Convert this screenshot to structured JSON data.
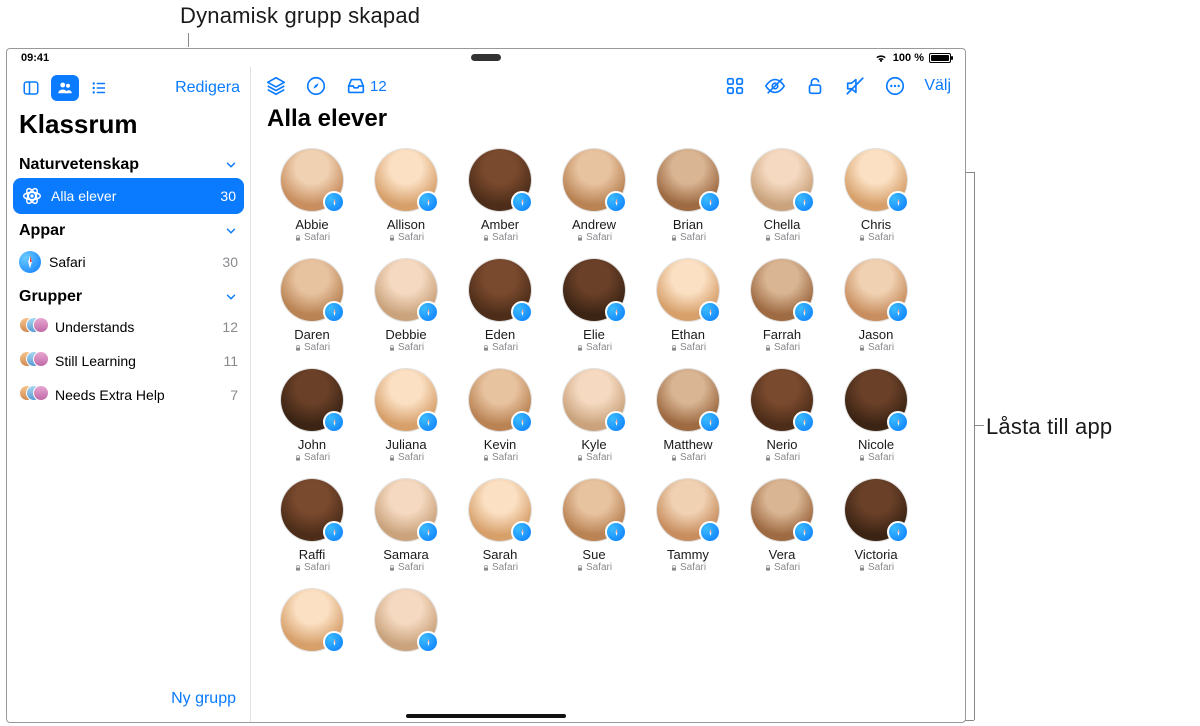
{
  "callouts": {
    "top": "Dynamisk grupp skapad",
    "right": "Låsta till app"
  },
  "statusbar": {
    "time": "09:41",
    "battery_pct": "100 %"
  },
  "sidebar": {
    "edit_label": "Redigera",
    "app_title": "Klassrum",
    "sections": {
      "subject": {
        "name": "Naturvetenskap",
        "all_students": "Alla elever",
        "all_count": "30"
      },
      "apps": {
        "header": "Appar",
        "items": [
          {
            "name": "Safari",
            "count": "30"
          }
        ]
      },
      "groups": {
        "header": "Grupper",
        "items": [
          {
            "name": "Understands",
            "count": "12"
          },
          {
            "name": "Still Learning",
            "count": "11"
          },
          {
            "name": "Needs Extra Help",
            "count": "7"
          }
        ]
      }
    },
    "new_group_label": "Ny grupp"
  },
  "main": {
    "page_title": "Alla elever",
    "select_label": "Välj",
    "inbox_count": "12",
    "student_app": "Safari",
    "students": [
      {
        "name": "Abbie",
        "c": 0
      },
      {
        "name": "Allison",
        "c": 1
      },
      {
        "name": "Amber",
        "c": 2
      },
      {
        "name": "Andrew",
        "c": 3
      },
      {
        "name": "Brian",
        "c": 4
      },
      {
        "name": "Chella",
        "c": 5
      },
      {
        "name": "Chris",
        "c": 1
      },
      {
        "name": "Daren",
        "c": 3
      },
      {
        "name": "Debbie",
        "c": 5
      },
      {
        "name": "Eden",
        "c": 2
      },
      {
        "name": "Elie",
        "c": 6
      },
      {
        "name": "Ethan",
        "c": 1
      },
      {
        "name": "Farrah",
        "c": 4
      },
      {
        "name": "Jason",
        "c": 0
      },
      {
        "name": "John",
        "c": 6
      },
      {
        "name": "Juliana",
        "c": 1
      },
      {
        "name": "Kevin",
        "c": 3
      },
      {
        "name": "Kyle",
        "c": 5
      },
      {
        "name": "Matthew",
        "c": 4
      },
      {
        "name": "Nerio",
        "c": 2
      },
      {
        "name": "Nicole",
        "c": 6
      },
      {
        "name": "Raffi",
        "c": 2
      },
      {
        "name": "Samara",
        "c": 5
      },
      {
        "name": "Sarah",
        "c": 1
      },
      {
        "name": "Sue",
        "c": 3
      },
      {
        "name": "Tammy",
        "c": 0
      },
      {
        "name": "Vera",
        "c": 4
      },
      {
        "name": "Victoria",
        "c": 6
      },
      {
        "name": "",
        "c": 1
      },
      {
        "name": "",
        "c": 5
      }
    ]
  }
}
